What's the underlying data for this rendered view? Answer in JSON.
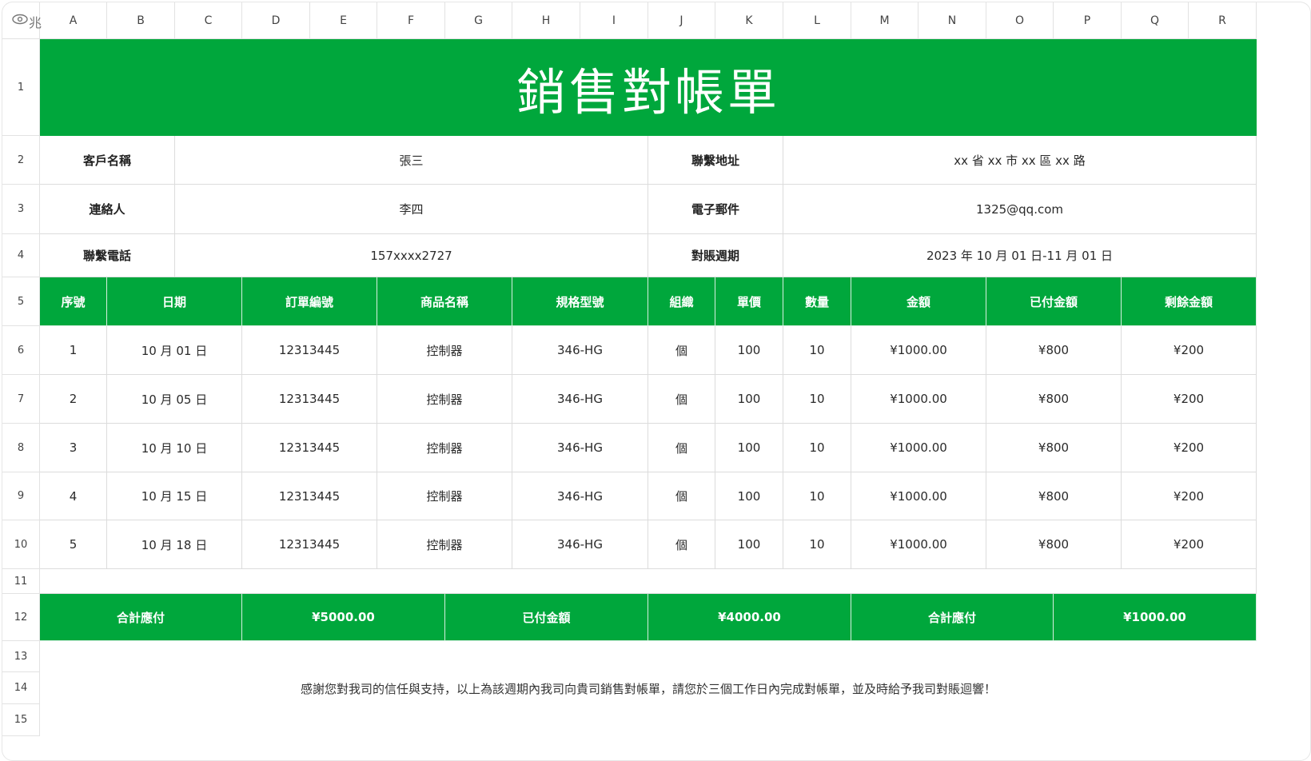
{
  "columns": [
    "A",
    "B",
    "C",
    "D",
    "E",
    "F",
    "G",
    "H",
    "I",
    "J",
    "K",
    "L",
    "M",
    "N",
    "O",
    "P",
    "Q",
    "R"
  ],
  "rows": [
    "1",
    "2",
    "3",
    "4",
    "5",
    "6",
    "7",
    "8",
    "9",
    "10",
    "11",
    "12",
    "13",
    "14",
    "15"
  ],
  "corner_glyph": "兆",
  "title": "銷售對帳單",
  "info": {
    "customer_label": "客戶名稱",
    "customer_value": "張三",
    "address_label": "聯繫地址",
    "address_value": "xx 省 xx 市 xx 區 xx 路",
    "contact_label": "連絡人",
    "contact_value": "李四",
    "email_label": "電子郵件",
    "email_value": "1325@qq.com",
    "phone_label": "聯繫電話",
    "phone_value": "157xxxx2727",
    "period_label": "對賬週期",
    "period_value": "2023 年 10 月 01 日-11 月 01 日"
  },
  "table": {
    "headers": [
      "序號",
      "日期",
      "訂單編號",
      "商品名稱",
      "規格型號",
      "組織",
      "單價",
      "數量",
      "金額",
      "已付金額",
      "剩餘金額"
    ],
    "rows": [
      [
        "1",
        "10 月 01 日",
        "12313445",
        "控制器",
        "346-HG",
        "個",
        "100",
        "10",
        "¥1000.00",
        "¥800",
        "¥200"
      ],
      [
        "2",
        "10 月 05 日",
        "12313445",
        "控制器",
        "346-HG",
        "個",
        "100",
        "10",
        "¥1000.00",
        "¥800",
        "¥200"
      ],
      [
        "3",
        "10 月 10 日",
        "12313445",
        "控制器",
        "346-HG",
        "個",
        "100",
        "10",
        "¥1000.00",
        "¥800",
        "¥200"
      ],
      [
        "4",
        "10 月 15 日",
        "12313445",
        "控制器",
        "346-HG",
        "個",
        "100",
        "10",
        "¥1000.00",
        "¥800",
        "¥200"
      ],
      [
        "5",
        "10 月 18 日",
        "12313445",
        "控制器",
        "346-HG",
        "個",
        "100",
        "10",
        "¥1000.00",
        "¥800",
        "¥200"
      ]
    ]
  },
  "totals": {
    "total_due_label": "合計應付",
    "total_due_value": "¥5000.00",
    "paid_label": "已付金額",
    "paid_value": "¥4000.00",
    "balance_label": "合計應付",
    "balance_value": "¥1000.00"
  },
  "footer_note": "感謝您對我司的信任與支持，以上為該週期內我司向貴司銷售對帳單，請您於三個工作日內完成對帳單，並及時給予我司對賬迴響！",
  "colors": {
    "accent": "#00a73c",
    "grid": "#dcdcdc",
    "header_text": "#ffffff"
  }
}
